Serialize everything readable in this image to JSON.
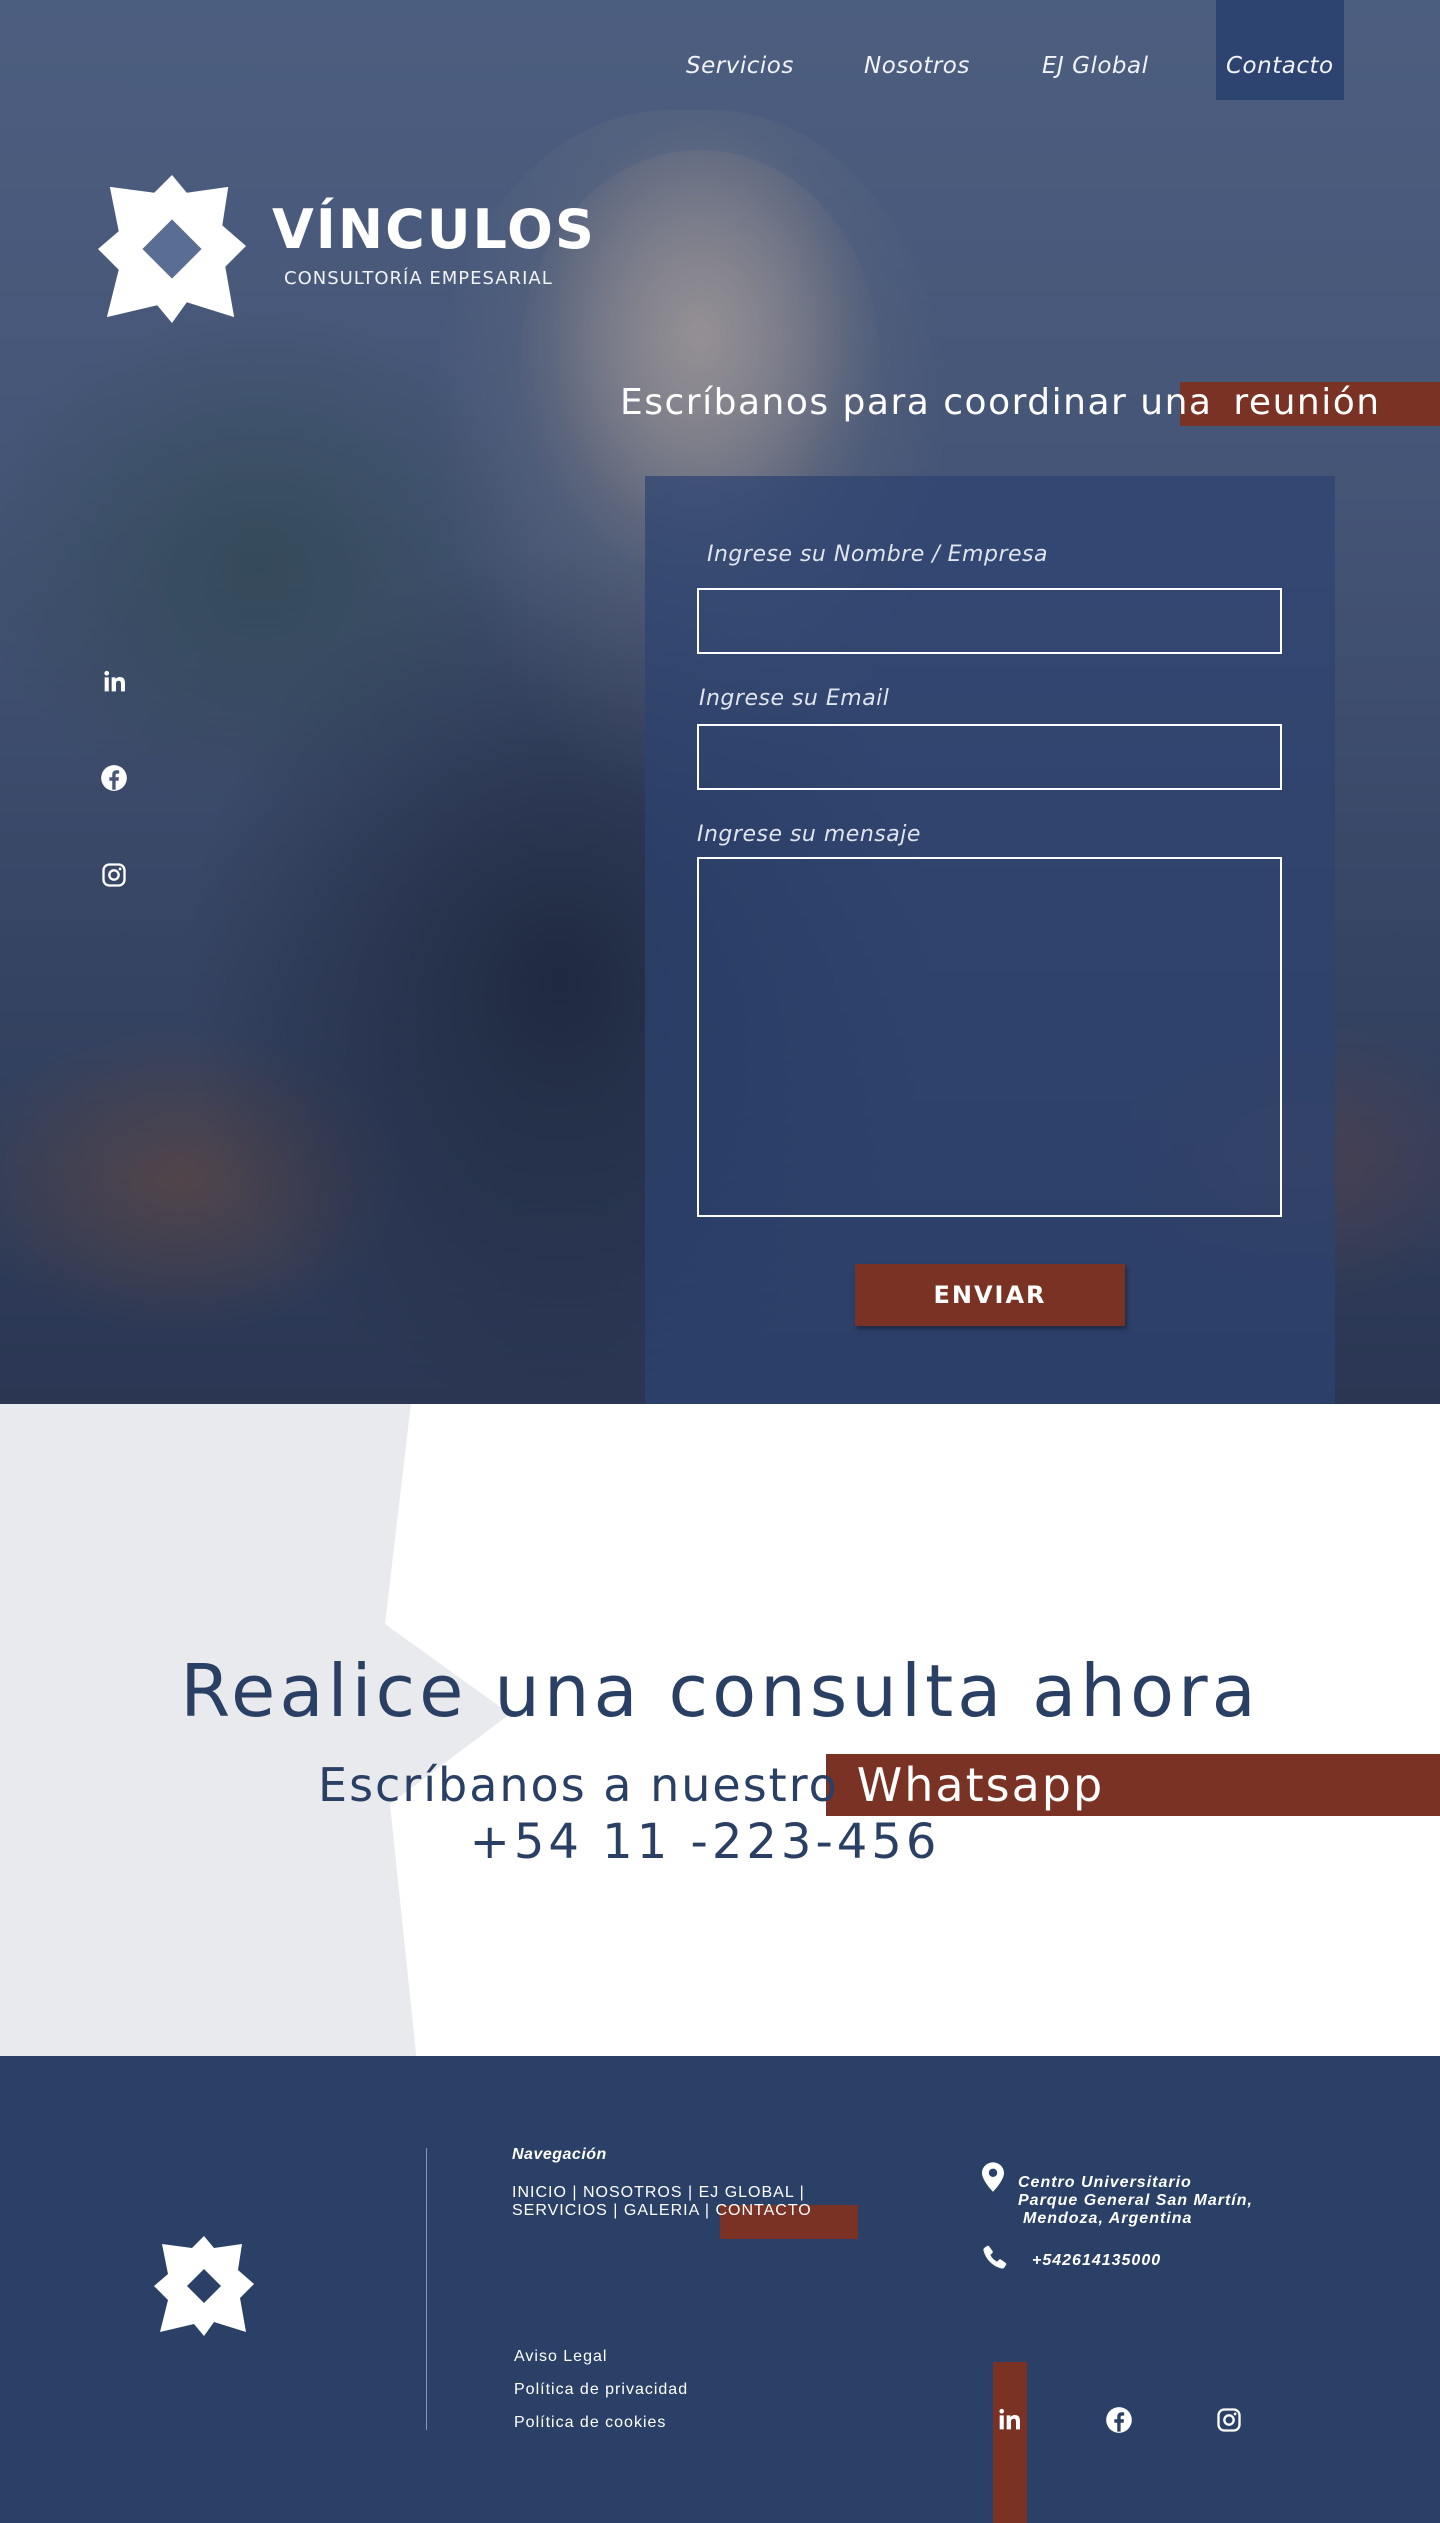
{
  "nav": {
    "items": [
      {
        "label": "Servicios"
      },
      {
        "label": "Nosotros"
      },
      {
        "label": "EJ Global"
      },
      {
        "label": "Contacto"
      }
    ]
  },
  "brand": {
    "name": "VÍNCULOS",
    "tagline": "CONSULTORÍA EMPESARIAL"
  },
  "hero": {
    "heading_text": "Escríbanos para coordinar una",
    "heading_highlight": "reunión"
  },
  "form": {
    "name_label": "Ingrese su Nombre / Empresa",
    "email_label": "Ingrese su Email",
    "message_label": "Ingrese su mensaje",
    "name_value": "",
    "email_value": "",
    "message_value": "",
    "submit_label": "ENVIAR"
  },
  "consult": {
    "title": "Realice una consulta ahora",
    "subtitle_text": "Escríbanos a nuestro",
    "subtitle_highlight": "Whatsapp",
    "phone": "+54 11 -223-456"
  },
  "footer": {
    "nav_title": "Navegación",
    "links_row1": [
      "INICIO",
      "NOSOTROS",
      "EJ GLOBAL"
    ],
    "links_row2": [
      "SERVICIOS",
      "GALERIA",
      "CONTACTO"
    ],
    "separator": "|",
    "legal": [
      "Aviso Legal",
      "Política de privacidad",
      "Política de cookies"
    ],
    "address_lines": [
      "Centro Universitario",
      "Parque General San Martín,",
      "Mendoza, Argentina"
    ],
    "phone": "+542614135000"
  },
  "icons": {
    "social": [
      "linkedin-icon",
      "facebook-icon",
      "instagram-icon"
    ],
    "contact": [
      "location-pin-icon",
      "phone-icon"
    ]
  },
  "colors": {
    "navy": "#2a4066",
    "accent": "#7a3224",
    "text_dark": "#2a3f64",
    "star_bg": "#e9eaee",
    "white": "#ffffff"
  }
}
